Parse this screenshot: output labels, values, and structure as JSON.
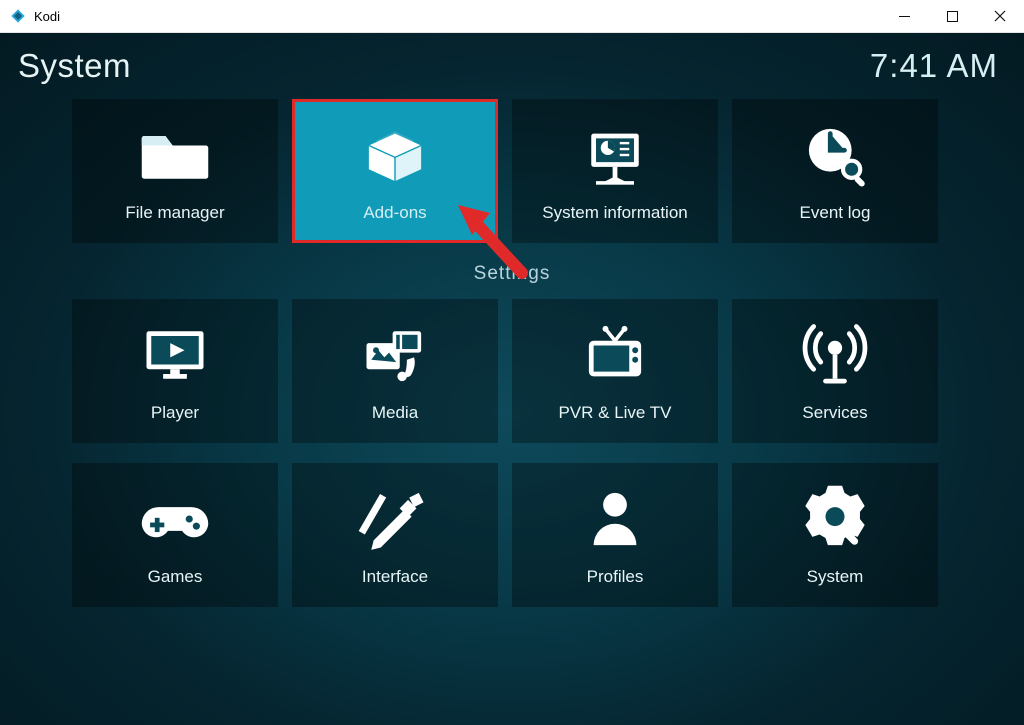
{
  "window": {
    "title": "Kodi"
  },
  "header": {
    "page_title": "System",
    "clock": "7:41 AM"
  },
  "top_tiles": [
    {
      "id": "file-manager",
      "label": "File manager",
      "icon": "folder-icon",
      "selected": false
    },
    {
      "id": "addons",
      "label": "Add-ons",
      "icon": "box-icon",
      "selected": true
    },
    {
      "id": "system-information",
      "label": "System information",
      "icon": "presentation-chart-icon",
      "selected": false
    },
    {
      "id": "event-log",
      "label": "Event log",
      "icon": "clock-search-icon",
      "selected": false
    }
  ],
  "settings_section_label": "Settings",
  "settings_tiles_row1": [
    {
      "id": "player",
      "label": "Player",
      "icon": "monitor-play-icon"
    },
    {
      "id": "media",
      "label": "Media",
      "icon": "media-library-icon"
    },
    {
      "id": "pvr-live-tv",
      "label": "PVR & Live TV",
      "icon": "tv-icon"
    },
    {
      "id": "services",
      "label": "Services",
      "icon": "broadcast-icon"
    }
  ],
  "settings_tiles_row2": [
    {
      "id": "games",
      "label": "Games",
      "icon": "gamepad-icon"
    },
    {
      "id": "interface",
      "label": "Interface",
      "icon": "design-tools-icon"
    },
    {
      "id": "profiles",
      "label": "Profiles",
      "icon": "person-icon"
    },
    {
      "id": "system",
      "label": "System",
      "icon": "gear-tool-icon"
    }
  ],
  "annotation": {
    "arrow_color": "#e02a2a"
  }
}
